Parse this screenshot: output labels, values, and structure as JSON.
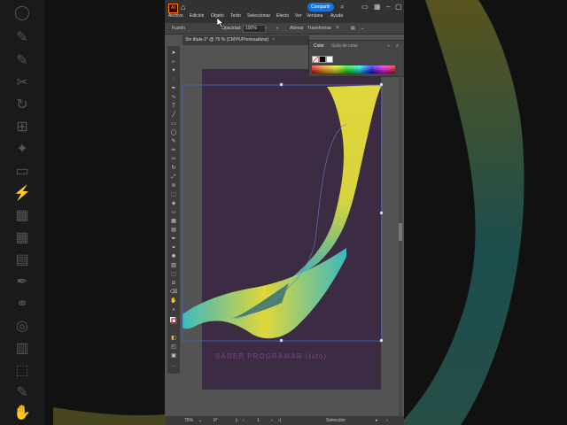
{
  "app": {
    "logo": "Ai",
    "share_label": "Compartir"
  },
  "menu": [
    "Archivo",
    "Edición",
    "Objeto",
    "Texto",
    "Seleccionar",
    "Efecto",
    "Ver",
    "Ventana",
    "Ayuda"
  ],
  "control": {
    "mode": "Fusión",
    "opacity_label": "Opacidad:",
    "opacity_value": "100%",
    "align": "Alinear",
    "transform": "Transformar"
  },
  "document": {
    "tab_title": "Sin título-1* @ 75 % (CMYK/Previsualizar)",
    "close": "×"
  },
  "color_panel": {
    "tab_color": "Color",
    "tab_guide": "Guía de color"
  },
  "artwork": {
    "text_main": "SABER PROGRAMAR",
    "text_extra": "(txto)"
  },
  "status": {
    "zoom": "75%",
    "rotation": "0°",
    "page": "1",
    "tool": "Selección"
  },
  "colors": {
    "wave_yellow": "#e8e03a",
    "wave_teal": "#3cc0c4",
    "artboard": "#3b2c44"
  }
}
